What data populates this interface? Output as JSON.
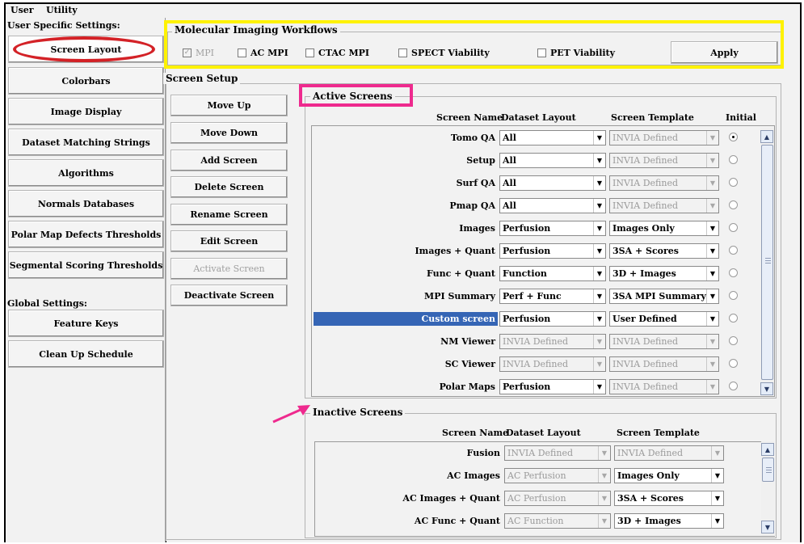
{
  "menu": {
    "user": "User",
    "utility": "Utility"
  },
  "sidebar": {
    "user_specific_heading": "User Specific Settings:",
    "user_items": [
      {
        "label": "Screen Layout",
        "selected": true
      },
      {
        "label": "Colorbars"
      },
      {
        "label": "Image Display"
      },
      {
        "label": "Dataset Matching Strings"
      },
      {
        "label": "Algorithms"
      },
      {
        "label": "Normals Databases"
      },
      {
        "label": "Polar Map Defects Thresholds"
      },
      {
        "label": "Segmental Scoring Thresholds"
      }
    ],
    "global_heading": "Global Settings:",
    "global_items": [
      {
        "label": "Feature Keys"
      },
      {
        "label": "Clean Up Schedule"
      }
    ]
  },
  "workflows": {
    "title": "Molecular Imaging Workflows",
    "options": [
      {
        "label": "MPI",
        "checked": true,
        "disabled": true
      },
      {
        "label": "AC MPI",
        "checked": false,
        "disabled": false
      },
      {
        "label": "CTAC MPI",
        "checked": false,
        "disabled": false
      },
      {
        "label": "SPECT Viability",
        "checked": false,
        "disabled": false
      },
      {
        "label": "PET Viability",
        "checked": false,
        "disabled": false
      }
    ],
    "apply_label": "Apply"
  },
  "screen_setup": {
    "title": "Screen Setup",
    "buttons": [
      {
        "label": "Move Up"
      },
      {
        "label": "Move Down"
      },
      {
        "label": "Add Screen"
      },
      {
        "label": "Delete Screen"
      },
      {
        "label": "Rename Screen"
      },
      {
        "label": "Edit Screen"
      },
      {
        "label": "Activate Screen",
        "disabled": true
      },
      {
        "label": "Deactivate Screen"
      }
    ]
  },
  "active_screens": {
    "title": "Active Screens",
    "headers": {
      "screen_name": "Screen Name",
      "dataset_layout": "Dataset Layout",
      "screen_template": "Screen Template",
      "initial": "Initial"
    },
    "rows": [
      {
        "name": "Tomo QA",
        "layout": "All",
        "template": "INVIA Defined",
        "template_disabled": true,
        "initial": true
      },
      {
        "name": "Setup",
        "layout": "All",
        "template": "INVIA Defined",
        "template_disabled": true
      },
      {
        "name": "Surf QA",
        "layout": "All",
        "template": "INVIA Defined",
        "template_disabled": true
      },
      {
        "name": "Pmap QA",
        "layout": "All",
        "template": "INVIA Defined",
        "template_disabled": true
      },
      {
        "name": "Images",
        "layout": "Perfusion",
        "template": "Images Only"
      },
      {
        "name": "Images + Quant",
        "layout": "Perfusion",
        "template": "3SA + Scores"
      },
      {
        "name": "Func + Quant",
        "layout": "Function",
        "template": "3D + Images"
      },
      {
        "name": "MPI Summary",
        "layout": "Perf + Func",
        "template": "3SA MPI Summary"
      },
      {
        "name": "Custom screen",
        "layout": "Perfusion",
        "template": "User Defined",
        "selected": true
      },
      {
        "name": "NM Viewer",
        "layout": "INVIA Defined",
        "layout_disabled": true,
        "template": "INVIA Defined",
        "template_disabled": true
      },
      {
        "name": "SC Viewer",
        "layout": "INVIA Defined",
        "layout_disabled": true,
        "template": "INVIA Defined",
        "template_disabled": true
      },
      {
        "name": "Polar Maps",
        "layout": "Perfusion",
        "template": "INVIA Defined",
        "template_disabled": true
      }
    ]
  },
  "inactive_screens": {
    "title": "Inactive Screens",
    "headers": {
      "screen_name": "Screen Name",
      "dataset_layout": "Dataset Layout",
      "screen_template": "Screen Template"
    },
    "rows": [
      {
        "name": "Fusion",
        "layout": "INVIA Defined",
        "layout_disabled": true,
        "template": "INVIA Defined",
        "template_disabled": true
      },
      {
        "name": "AC Images",
        "layout": "AC Perfusion",
        "layout_disabled": true,
        "template": "Images Only"
      },
      {
        "name": "AC Images + Quant",
        "layout": "AC Perfusion",
        "layout_disabled": true,
        "template": "3SA + Scores"
      },
      {
        "name": "AC Func + Quant",
        "layout": "AC Function",
        "layout_disabled": true,
        "template": "3D + Images"
      }
    ]
  },
  "annotation_colors": {
    "ellipse": "#d32126",
    "workflows_box": "#fef200",
    "active_box": "#ee2a8e",
    "arrow": "#ee2a8e"
  }
}
